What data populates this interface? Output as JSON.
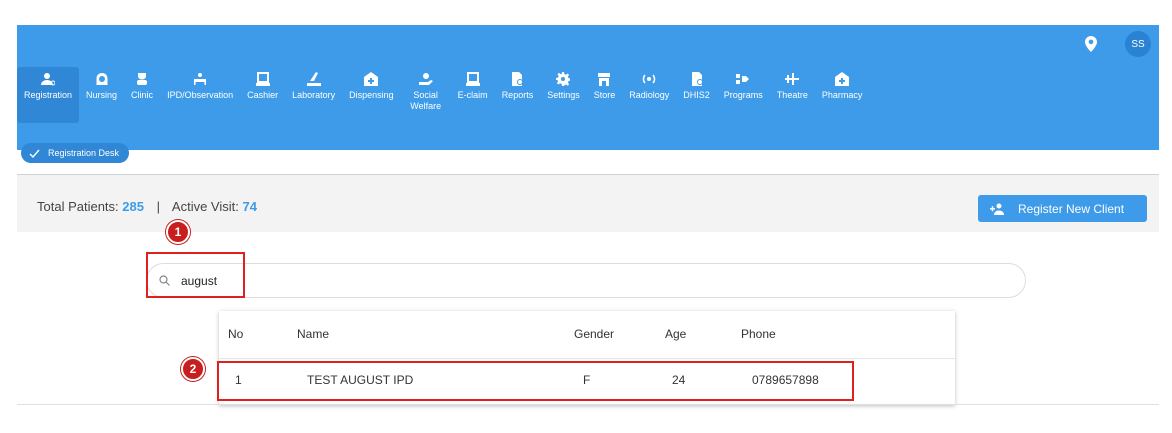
{
  "header": {
    "avatar_initials": "SS"
  },
  "nav": [
    {
      "label": "Registration",
      "icon": "user-badge-icon",
      "active": true
    },
    {
      "label": "Nursing",
      "icon": "nurse-icon"
    },
    {
      "label": "Clinic",
      "icon": "clinic-icon"
    },
    {
      "label": "IPD/Observation",
      "icon": "bed-icon"
    },
    {
      "label": "Cashier",
      "icon": "register-icon"
    },
    {
      "label": "Laboratory",
      "icon": "flask-icon"
    },
    {
      "label": "Dispensing",
      "icon": "medicine-box-icon"
    },
    {
      "label": "Social Welfare",
      "icon": "hand-heart-icon"
    },
    {
      "label": "E-claim",
      "icon": "laptop-icon"
    },
    {
      "label": "Reports",
      "icon": "report-icon"
    },
    {
      "label": "Settings",
      "icon": "gear-icon"
    },
    {
      "label": "Store",
      "icon": "store-icon"
    },
    {
      "label": "Radiology",
      "icon": "radiation-icon"
    },
    {
      "label": "DHIS2",
      "icon": "report-icon"
    },
    {
      "label": "Programs",
      "icon": "programs-icon"
    },
    {
      "label": "Theatre",
      "icon": "scalpel-icon"
    },
    {
      "label": "Pharmacy",
      "icon": "medicine-box-icon"
    }
  ],
  "chip": {
    "label": "Registration Desk"
  },
  "stats": {
    "total_label": "Total Patients:",
    "total_value": "285",
    "separator": "|",
    "active_label": "Active Visit:",
    "active_value": "74"
  },
  "register_button": {
    "label": "Register New Client"
  },
  "search": {
    "value": "august"
  },
  "results": {
    "headers": [
      "No",
      "Name",
      "Gender",
      "Age",
      "Phone"
    ],
    "rows": [
      {
        "no": "1",
        "name": "TEST AUGUST IPD",
        "gender": "F",
        "age": "24",
        "phone": "0789657898"
      }
    ]
  },
  "annotations": [
    "1",
    "2"
  ],
  "colors": {
    "primary": "#3d9be9",
    "primary_dark": "#2f87d6",
    "highlight": "#e02020",
    "badge": "#c81e1e"
  }
}
